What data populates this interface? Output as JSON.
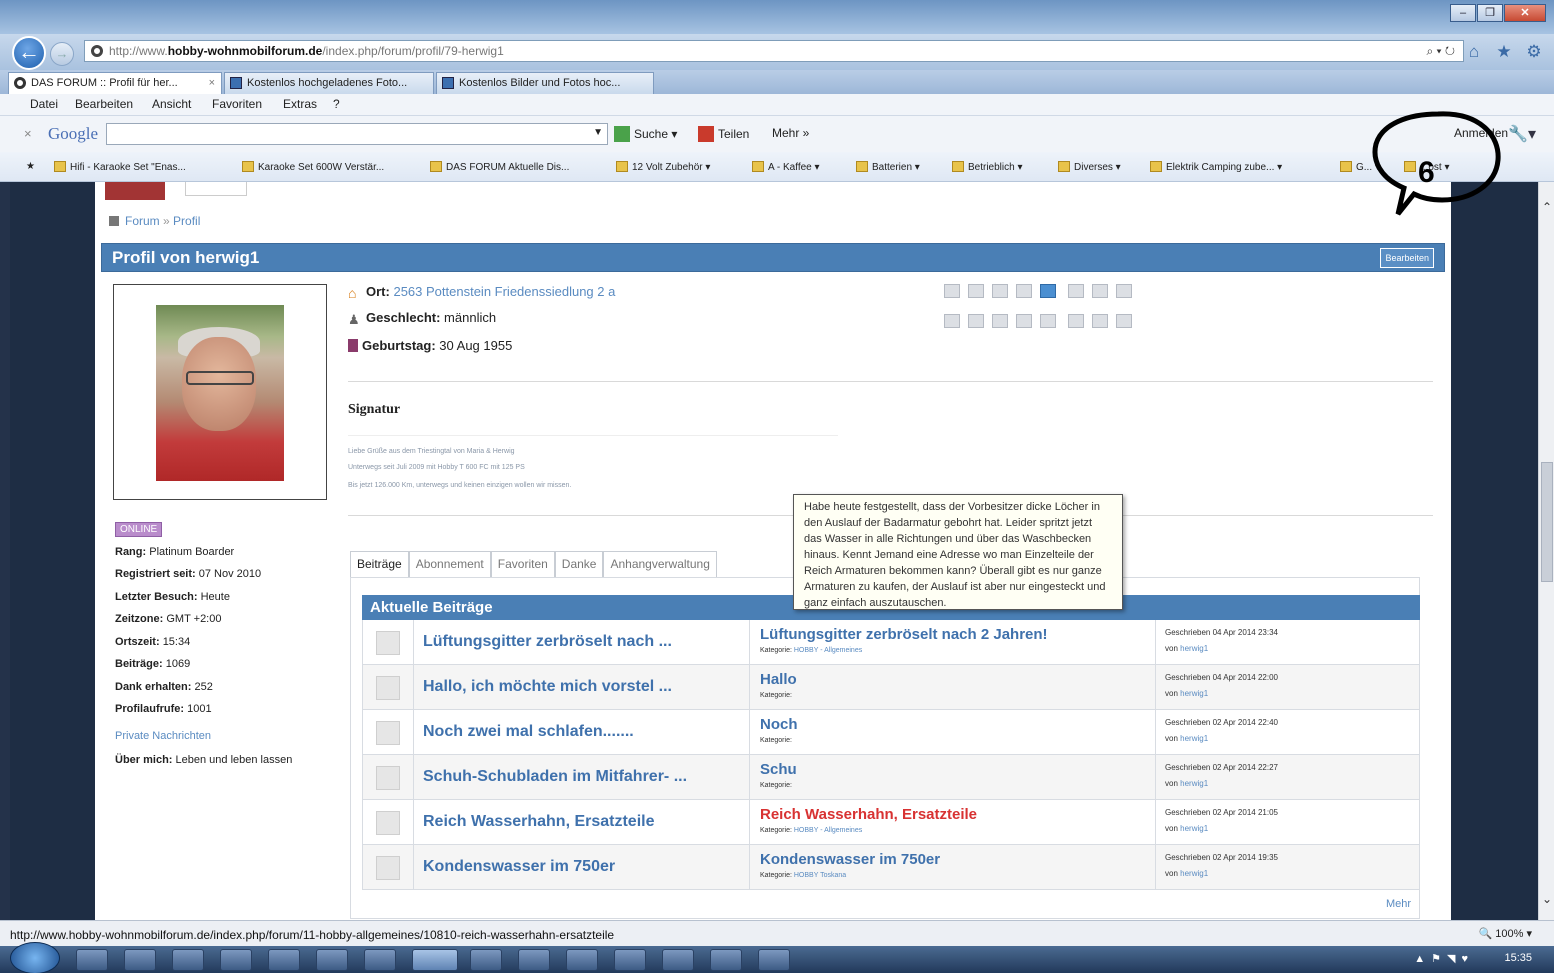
{
  "browser": {
    "address_url_prefix": "http://www.",
    "address_url_domain": "hobby-wohnmobilforum.de",
    "address_url_path": "/index.php/forum/profil/79-herwig1",
    "address_tools": "⌕ ▾ ↻",
    "nav_icons": [
      "home-icon",
      "star-icon",
      "gear-icon"
    ],
    "tabs": [
      {
        "label": "DAS FORUM :: Profil für her...",
        "close": "×",
        "active": true
      },
      {
        "label": "Kostenlos hochgeladenes Foto...",
        "active": false
      },
      {
        "label": "Kostenlos Bilder und Fotos hoc...",
        "active": false
      }
    ],
    "menu": [
      "Datei",
      "Bearbeiten",
      "Ansicht",
      "Favoriten",
      "Extras",
      "?"
    ],
    "google_bar": {
      "close": "×",
      "logo": "Google",
      "search_label": "Suche",
      "share_label": "Teilen",
      "more_label": "Mehr »",
      "signin_label": "Anmelden"
    },
    "favorites": [
      "Hifi - Karaoke Set \"Enas...",
      "Karaoke Set 600W Verstär...",
      "DAS FORUM Aktuelle Dis...",
      "12 Volt Zubehör ▾",
      "A - Kaffee ▾",
      "Batterien ▾",
      "Betrieblich ▾",
      "Diverses ▾",
      "Elektrik Camping zube... ▾",
      "G... ▾",
      "...ost ▾"
    ],
    "status_url": "http://www.hobby-wohnmobilforum.de/index.php/forum/11-hobby-allgemeines/10810-reich-wasserhahn-ersatzteile",
    "zoom": "🔍 100%  ▾",
    "clock": "15:35"
  },
  "page": {
    "breadcrumb": [
      "Forum",
      "Profil"
    ],
    "breadcrumb_sep": "»",
    "profile_title": "Profil von herwig1",
    "edit_label": "Bearbeiten",
    "location_label": "Ort:",
    "location_value": "2563 Pottenstein Friedenssiedlung 2 a",
    "gender_label": "Geschlecht:",
    "gender_value": "männlich",
    "birthday_label": "Geburtstag:",
    "birthday_value": "30 Aug 1955",
    "signature_heading": "Signatur",
    "signature_lines": [
      "Liebe Grüße aus dem Triestingtal von Maria & Herwig",
      "Unterwegs seit Juli 2009 mit Hobby T 600 FC mit 125 PS",
      "Bis jetzt 126.000 Km, unterwegs und keinen einzigen wollen wir missen."
    ],
    "online_badge": "ONLINE",
    "stats": [
      {
        "label": "Rang:",
        "value": "Platinum Boarder"
      },
      {
        "label": "Registriert seit:",
        "value": "07 Nov 2010"
      },
      {
        "label": "Letzter Besuch:",
        "value": "Heute"
      },
      {
        "label": "Zeitzone:",
        "value": "GMT +2:00"
      },
      {
        "label": "Ortszeit:",
        "value": "15:34"
      },
      {
        "label": "Beiträge:",
        "value": "1069"
      },
      {
        "label": "Dank erhalten:",
        "value": "252"
      },
      {
        "label": "Profilaufrufe:",
        "value": "1001"
      }
    ],
    "private_messages": "Private Nachrichten",
    "about_label": "Über mich:",
    "about_value": "Leben und leben lassen",
    "profile_tabs": [
      "Beiträge",
      "Abonnement",
      "Favoriten",
      "Danke",
      "Anhangverwaltung"
    ],
    "posts_header": "Aktuelle Beiträge",
    "posts": [
      {
        "short": "Lüftungsgitter zerbröselt nach ...",
        "full": "Lüftungsgitter zerbröselt nach 2 Jahren!",
        "cat_label": "Kategorie:",
        "category": "HOBBY - Allgemeines",
        "date": "Geschrieben 04 Apr 2014 23:34",
        "by": "von",
        "author": "herwig1"
      },
      {
        "short": "Hallo, ich möchte mich vorstel ...",
        "full": "Hallo",
        "cat_label": "Kategorie:",
        "category": "",
        "date": "Geschrieben 04 Apr 2014 22:00",
        "by": "von",
        "author": "herwig1"
      },
      {
        "short": "Noch zwei mal schlafen.......",
        "full": "Noch",
        "cat_label": "Kategorie:",
        "category": "",
        "date": "Geschrieben 02 Apr 2014 22:40",
        "by": "von",
        "author": "herwig1"
      },
      {
        "short": "Schuh-Schubladen im Mitfahrer- ...",
        "full": "Schu",
        "cat_label": "Kategorie:",
        "category": "",
        "date": "Geschrieben 02 Apr 2014 22:27",
        "by": "von",
        "author": "herwig1"
      },
      {
        "short": "Reich Wasserhahn, Ersatzteile",
        "full": "Reich Wasserhahn, Ersatzteile",
        "cat_label": "Kategorie:",
        "category": "HOBBY - Allgemeines",
        "date": "Geschrieben 02 Apr 2014 21:05",
        "by": "von",
        "author": "herwig1"
      },
      {
        "short": "Kondenswasser im 750er",
        "full": "Kondenswasser im 750er",
        "cat_label": "Kategorie:",
        "category": "HOBBY Toskana",
        "date": "Geschrieben 02 Apr 2014 19:35",
        "by": "von",
        "author": "herwig1"
      }
    ],
    "more_label": "Mehr",
    "tooltip": "Habe heute festgestellt, dass der Vorbesitzer dicke Löcher in den Auslauf der Badarmatur gebohrt hat. Leider spritzt jetzt das Wasser in alle Richtungen und über das Waschbecken hinaus. Kennt Jemand eine Adresse wo man Einzelteile der Reich Armaturen bekommen kann? Überall gibt es nur ganze Armaturen zu kaufen, der Auslauf ist aber nur eingesteckt und ganz einfach auszutauschen.",
    "callout_number": "6"
  },
  "colors": {
    "header_blue": "#4a7fb5",
    "link_blue": "#5a8bc1",
    "highlight_red": "#d83232",
    "online_purple": "#b98ccb"
  }
}
